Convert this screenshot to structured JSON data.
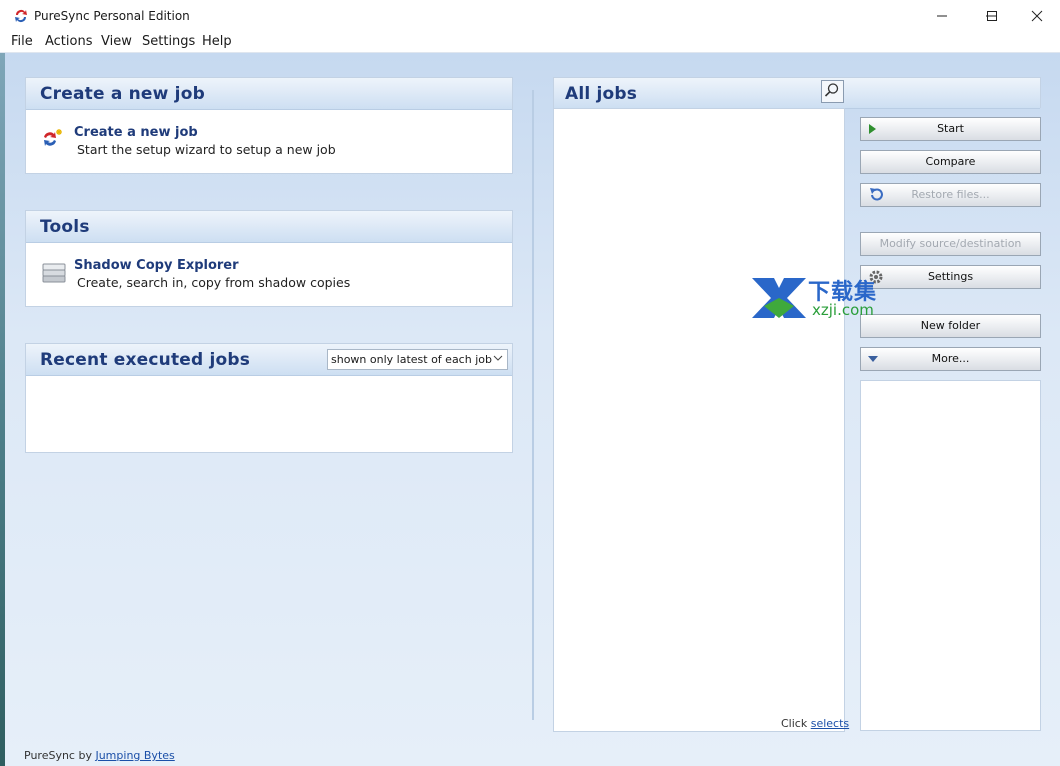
{
  "window": {
    "title": "PureSync Personal Edition",
    "controls": [
      "minimize-icon",
      "maximize-icon",
      "close-icon"
    ]
  },
  "menu": [
    "File",
    "Actions",
    "View",
    "Settings",
    "Help"
  ],
  "create_panel": {
    "title": "Create a new job",
    "item_title": "Create a new job",
    "item_desc": "Start the setup wizard to setup a new job",
    "icon": "sync-new-icon"
  },
  "tools_panel": {
    "title": "Tools",
    "item_title": "Shadow Copy Explorer",
    "item_desc": "Create, search in, copy from shadow copies",
    "icon": "drive-stack-icon"
  },
  "recent_panel": {
    "title": "Recent executed jobs",
    "filter_selected": "shown only latest of each job"
  },
  "all_jobs": {
    "title": "All jobs",
    "search_icon": "search-icon",
    "hint_prefix": "Click",
    "hint_link": "selects"
  },
  "buttons": {
    "start": "Start",
    "compare": "Compare",
    "restore": "Restore files...",
    "modify": "Modify source/destination",
    "settings": "Settings",
    "new_folder": "New folder",
    "more": "More..."
  },
  "footer": {
    "prefix": "PureSync by",
    "link": "Jumping Bytes"
  },
  "watermark": {
    "top": "下载集",
    "bottom": "xzji.com"
  },
  "colors": {
    "heading": "#1f3b7a",
    "link": "#1b4fa8",
    "background": "#cfe0f1"
  }
}
